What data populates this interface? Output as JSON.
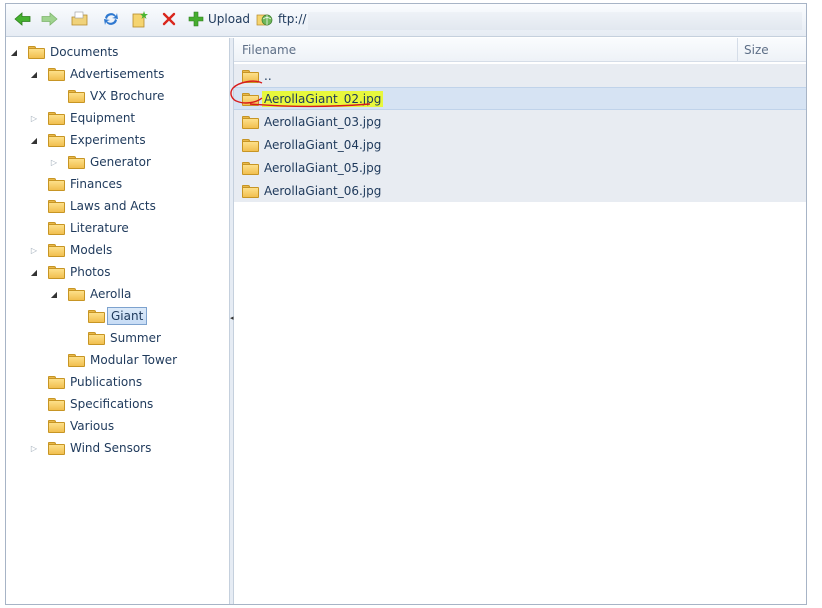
{
  "toolbar": {
    "back_icon": "arrow-left-green",
    "forward_icon": "arrow-right-green",
    "up_icon": "folder-up",
    "refresh_icon": "refresh-blue",
    "new_folder_icon": "folder-new",
    "delete_icon": "delete-red-x",
    "upload_label": "Upload",
    "address_label": "ftp://"
  },
  "tree": [
    {
      "label": "Documents",
      "level": 0,
      "state": "expanded"
    },
    {
      "label": "Advertisements",
      "level": 1,
      "state": "expanded"
    },
    {
      "label": "VX Brochure",
      "level": 2,
      "state": "none"
    },
    {
      "label": "Equipment",
      "level": 1,
      "state": "collapsed"
    },
    {
      "label": "Experiments",
      "level": 1,
      "state": "expanded"
    },
    {
      "label": "Generator",
      "level": 2,
      "state": "collapsed"
    },
    {
      "label": "Finances",
      "level": 1,
      "state": "none"
    },
    {
      "label": "Laws and Acts",
      "level": 1,
      "state": "none"
    },
    {
      "label": "Literature",
      "level": 1,
      "state": "none"
    },
    {
      "label": "Models",
      "level": 1,
      "state": "collapsed"
    },
    {
      "label": "Photos",
      "level": 1,
      "state": "expanded"
    },
    {
      "label": "Aerolla",
      "level": 2,
      "state": "expanded"
    },
    {
      "label": "Giant",
      "level": 3,
      "state": "none",
      "selected": true
    },
    {
      "label": "Summer",
      "level": 3,
      "state": "none"
    },
    {
      "label": "Modular Tower",
      "level": 2,
      "state": "none"
    },
    {
      "label": "Publications",
      "level": 1,
      "state": "none"
    },
    {
      "label": "Specifications",
      "level": 1,
      "state": "none"
    },
    {
      "label": "Various",
      "level": 1,
      "state": "none"
    },
    {
      "label": "Wind Sensors",
      "level": 1,
      "state": "collapsed"
    }
  ],
  "grid": {
    "columns": {
      "filename": "Filename",
      "size": "Size"
    },
    "rows": [
      {
        "name": "..",
        "size": ""
      },
      {
        "name": "AerollaGiant_02.jpg",
        "size": "",
        "selected": true,
        "highlighted": true
      },
      {
        "name": "AerollaGiant_03.jpg",
        "size": ""
      },
      {
        "name": "AerollaGiant_04.jpg",
        "size": ""
      },
      {
        "name": "AerollaGiant_05.jpg",
        "size": ""
      },
      {
        "name": "AerollaGiant_06.jpg",
        "size": ""
      }
    ]
  },
  "colors": {
    "highlight": "#e8f83c",
    "annotation": "#d81c1c",
    "selection": "#d6e3f3",
    "folder": "#f1bf4f"
  }
}
